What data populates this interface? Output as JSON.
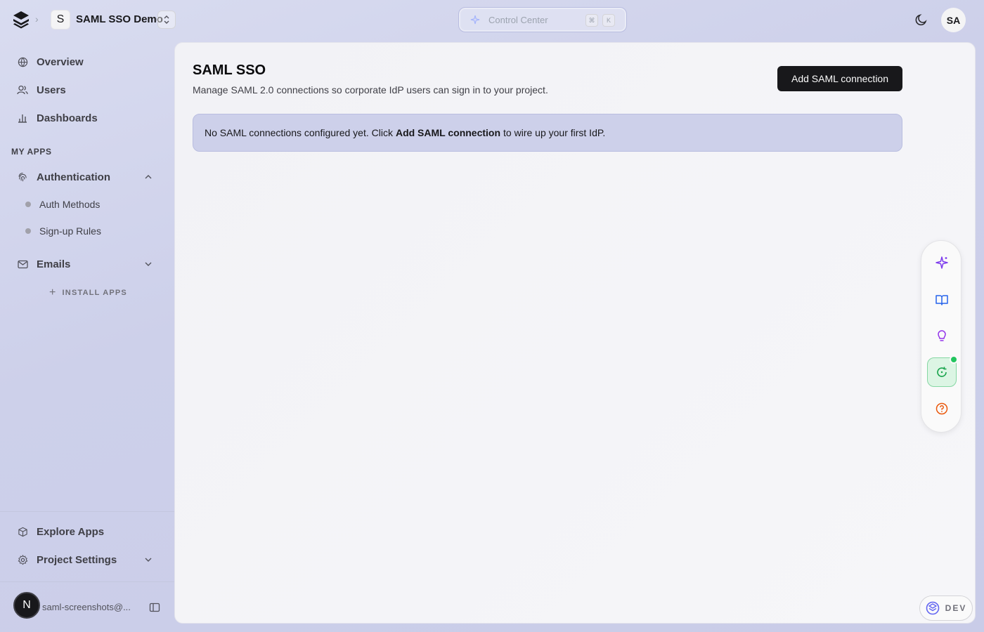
{
  "header": {
    "project_initial": "S",
    "project_name": "SAML SSO Demo",
    "control_center": {
      "placeholder": "Control Center",
      "kbd_mod": "⌘",
      "kbd_key": "K"
    },
    "user_initials": "SA"
  },
  "sidebar": {
    "top_items": [
      {
        "label": "Overview",
        "icon": "globe-icon"
      },
      {
        "label": "Users",
        "icon": "users-icon"
      },
      {
        "label": "Dashboards",
        "icon": "bar-chart-icon"
      }
    ],
    "section_label": "MY APPS",
    "apps": [
      {
        "label": "Authentication",
        "icon": "fingerprint-icon",
        "expanded": true,
        "children": [
          {
            "label": "Auth Methods"
          },
          {
            "label": "Sign-up Rules"
          }
        ]
      },
      {
        "label": "Emails",
        "icon": "mail-icon",
        "expanded": false
      }
    ],
    "install_label": "INSTALL APPS",
    "bottom_items": [
      {
        "label": "Explore Apps",
        "icon": "box-icon"
      },
      {
        "label": "Project Settings",
        "icon": "gear-icon"
      }
    ],
    "account": {
      "avatar_initial": "N",
      "email": "saml-screenshots@..."
    }
  },
  "main": {
    "title": "SAML SSO",
    "subtitle": "Manage SAML 2.0 connections so corporate IdP users can sign in to your project.",
    "add_button": "Add SAML connection",
    "notice": {
      "before": "No SAML connections configured yet. Click",
      "bold": "Add SAML connection",
      "after": "to wire up your first IdP."
    }
  },
  "right_toolbar": {
    "buttons": [
      {
        "icon": "sparkle-icon",
        "color": "#7c3aed"
      },
      {
        "icon": "book-open-icon",
        "color": "#2563eb"
      },
      {
        "icon": "lightbulb-icon",
        "color": "#9333ea"
      },
      {
        "icon": "refresh-icon",
        "color": "#16a34a",
        "active": true
      },
      {
        "icon": "help-icon",
        "color": "#ea580c"
      }
    ]
  },
  "dev_badge": {
    "label": "DEV"
  },
  "colors": {
    "accent_dark": "#18181b",
    "notice_bg": "#cdd0ea",
    "status_green": "#22c55e"
  }
}
